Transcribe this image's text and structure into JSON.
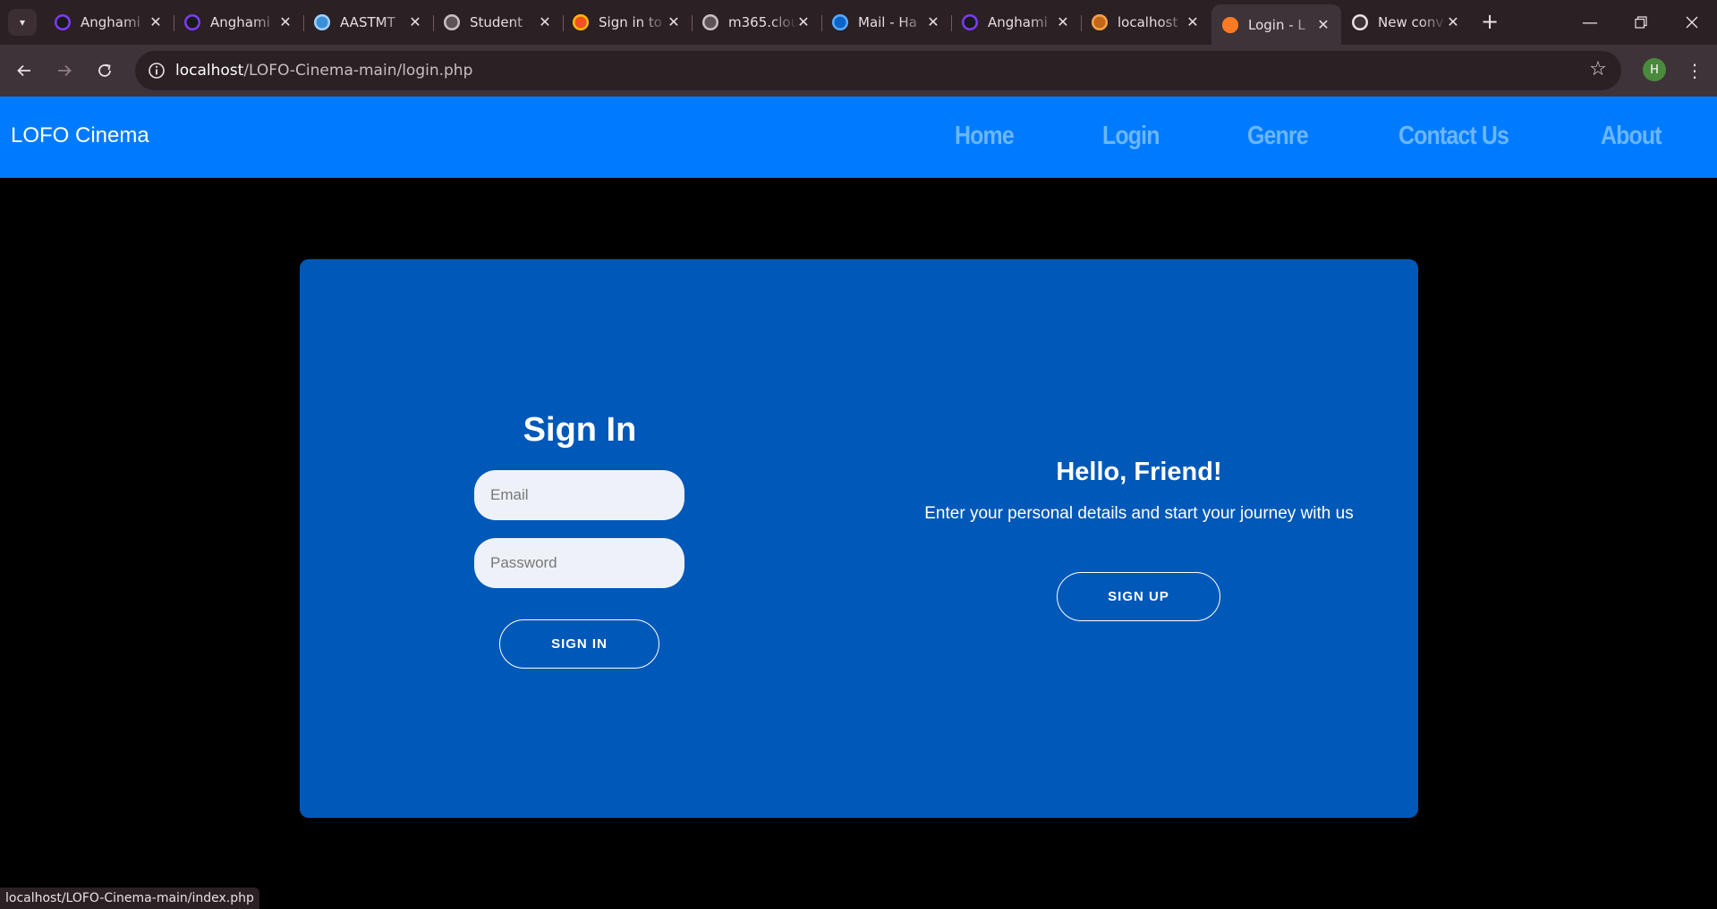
{
  "browser": {
    "tabs": [
      {
        "title": "Anghami",
        "favicon": "anghami-icon",
        "color": "#1a1a1a",
        "ring": "#7d3cff"
      },
      {
        "title": "Anghami",
        "favicon": "anghami-icon",
        "color": "#1a1a1a",
        "ring": "#7d3cff"
      },
      {
        "title": "AASTMT",
        "favicon": "aastmt-icon",
        "color": "#3a8fd6",
        "ring": "#9fd1ff"
      },
      {
        "title": "Student",
        "favicon": "globe-icon",
        "color": "#5e5358",
        "ring": "#c8bfc3"
      },
      {
        "title": "Sign in to",
        "favicon": "microsoft-icon",
        "color": "#f25022",
        "ring": "#ffb900"
      },
      {
        "title": "m365.cloud",
        "favicon": "globe-icon",
        "color": "#5e5358",
        "ring": "#c8bfc3"
      },
      {
        "title": "Mail - Ha",
        "favicon": "outlook-icon",
        "color": "#0a64c8",
        "ring": "#5aa9ff"
      },
      {
        "title": "Anghami",
        "favicon": "anghami-icon",
        "color": "#1a1a1a",
        "ring": "#7d3cff"
      },
      {
        "title": "localhost",
        "favicon": "xampp-icon",
        "color": "#c2671a",
        "ring": "#f4a24a"
      },
      {
        "title": "Login - L",
        "favicon": "xampp-icon",
        "color": "#fb7a24",
        "ring": "#fb7a24",
        "active": true
      },
      {
        "title": "New conv",
        "favicon": "copilot-icon",
        "color": "#3e3338",
        "ring": "#e8e2e4"
      }
    ],
    "url_host": "localhost",
    "url_path": "/LOFO-Cinema-main/login.php",
    "profile_initial": "H",
    "status_url": "localhost/LOFO-Cinema-main/index.php"
  },
  "site": {
    "brand": "LOFO Cinema",
    "nav": [
      "Home",
      "Login",
      "Genre",
      "Contact Us",
      "About"
    ]
  },
  "signin": {
    "title": "Sign In",
    "email_placeholder": "Email",
    "password_placeholder": "Password",
    "button": "SIGN IN"
  },
  "overlay": {
    "title": "Hello, Friend!",
    "text": "Enter your personal details and start your journey with us",
    "button": "SIGN UP"
  },
  "colors": {
    "nav_bg": "#007bff",
    "nav_link": "#6ab6ff",
    "card_bg": "#0058b8",
    "page_bg": "#000000"
  }
}
